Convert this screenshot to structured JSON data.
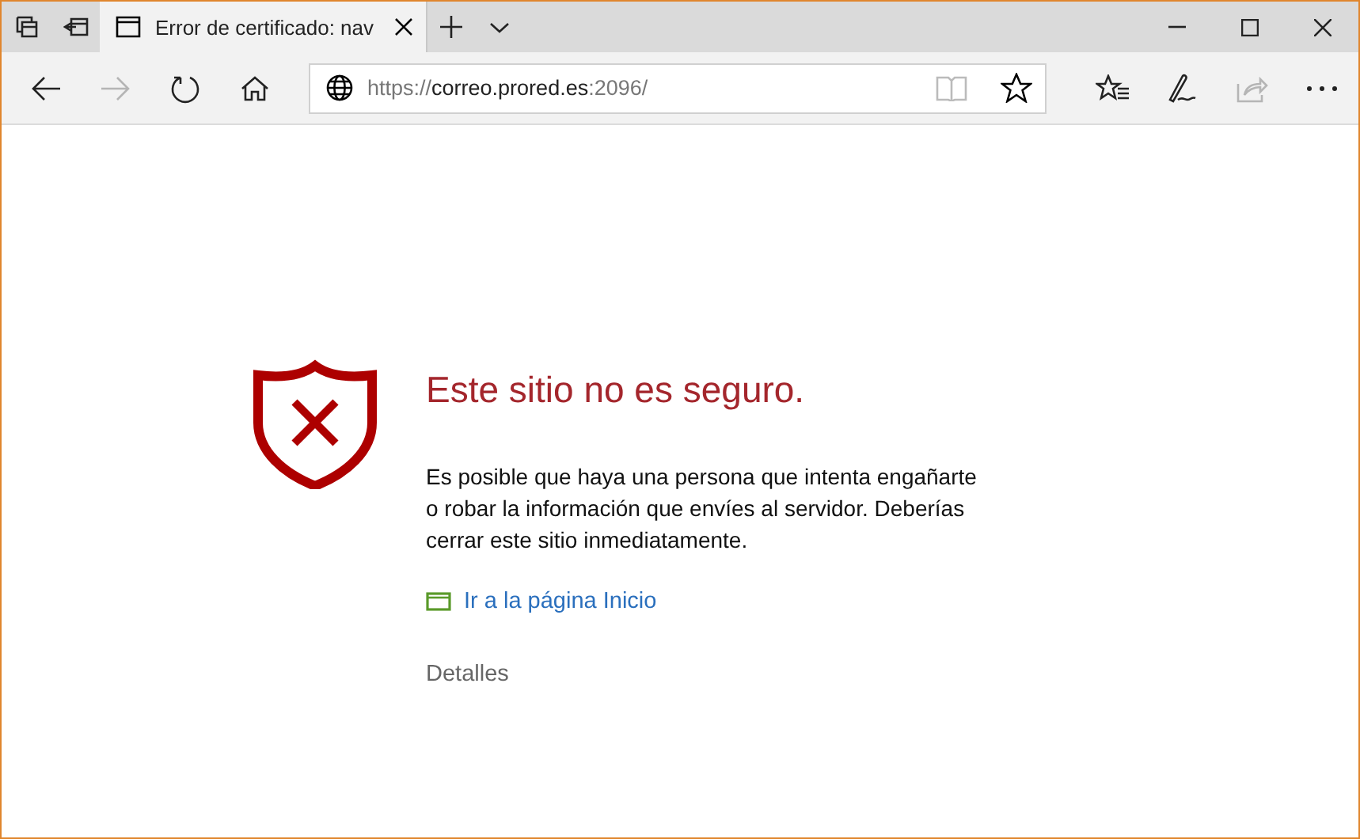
{
  "tab": {
    "title": "Error de certificado: nav",
    "selected": true
  },
  "nav_buttons": [
    {
      "kind": "back",
      "disabled": false
    },
    {
      "kind": "forward",
      "disabled": true
    },
    {
      "kind": "refresh",
      "disabled": false
    },
    {
      "kind": "home",
      "disabled": false
    }
  ],
  "address": {
    "scheme": "https://",
    "host": "correo.prored.es",
    "rest": ":2096/"
  },
  "toolbar_buttons": [
    {
      "kind": "favorites",
      "disabled": false
    },
    {
      "kind": "notes",
      "disabled": false
    },
    {
      "kind": "share",
      "disabled": true
    },
    {
      "kind": "more",
      "disabled": false
    }
  ],
  "page": {
    "heading": "Este sitio no es seguro.",
    "message": "Es posible que haya una persona que intenta engañarte o robar la información que envíes al servidor. Deberías cerrar este sitio inmediatamente.",
    "home_link": "Ir a la página Inicio",
    "details": "Detalles"
  }
}
